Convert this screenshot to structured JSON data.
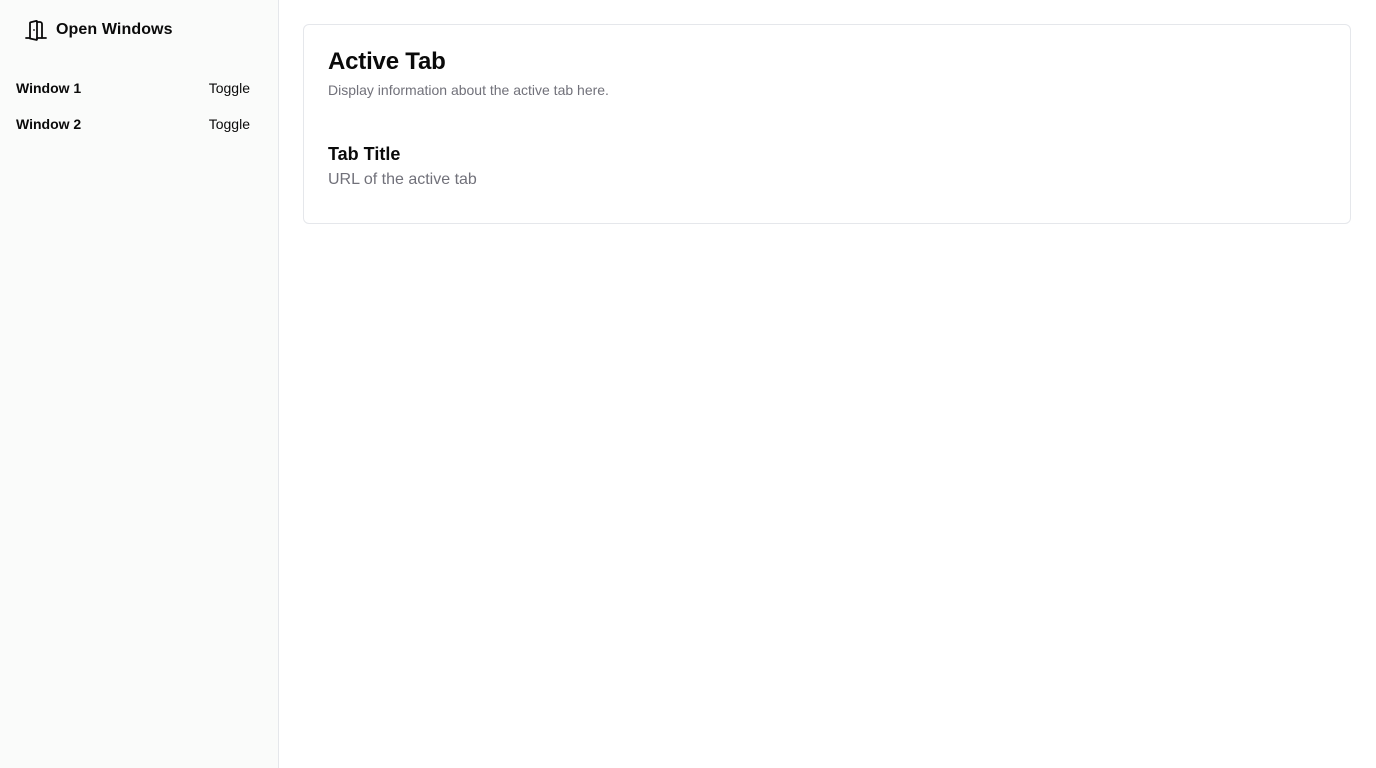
{
  "sidebar": {
    "title": "Open Windows",
    "icon": "door-open-icon",
    "windows": [
      {
        "label": "Window 1",
        "action": "Toggle"
      },
      {
        "label": "Window 2",
        "action": "Toggle"
      }
    ]
  },
  "main": {
    "card": {
      "title": "Active Tab",
      "description": "Display information about the active tab here.",
      "tab_title": "Tab Title",
      "tab_url": "URL of the active tab"
    }
  },
  "colors": {
    "sidebar_bg": "#fafbfa",
    "muted_text": "#71717a",
    "border": "#e5e7eb"
  }
}
